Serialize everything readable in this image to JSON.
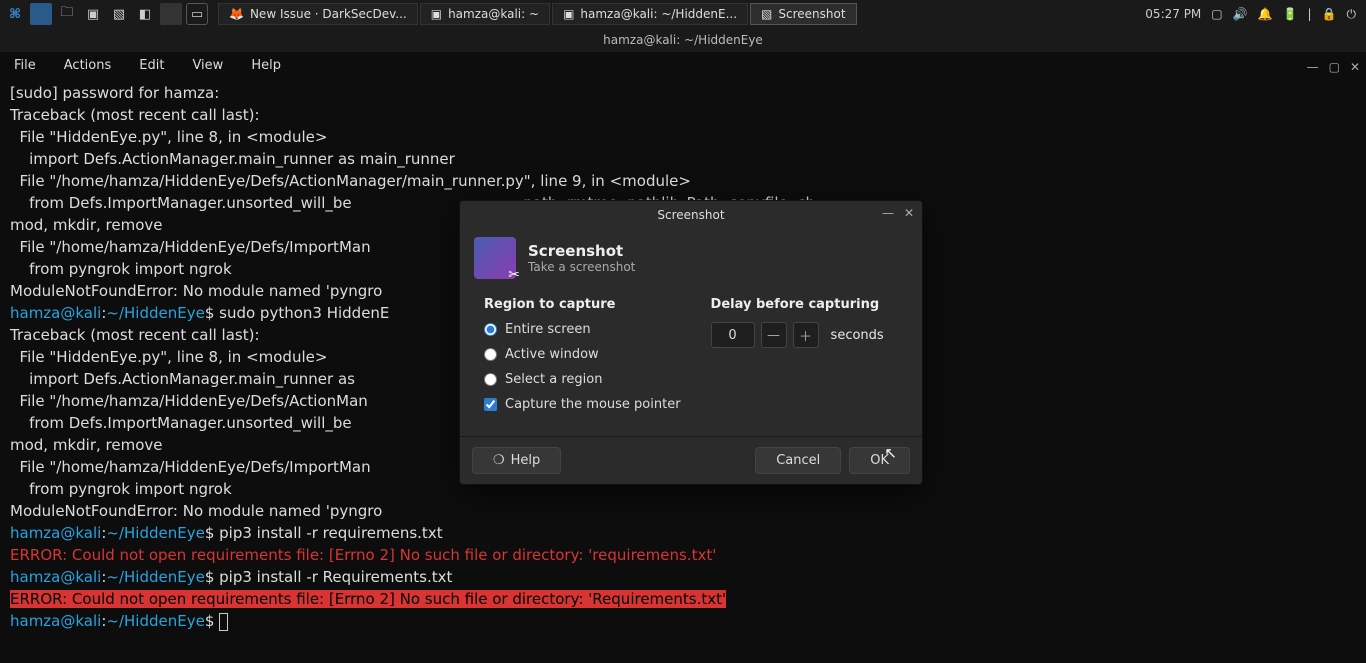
{
  "panel": {
    "tasks": [
      {
        "icon": "🦊",
        "label": "New Issue · DarkSecDev..."
      },
      {
        "icon": "▣",
        "label": "hamza@kali: ~"
      },
      {
        "icon": "▣",
        "label": "hamza@kali: ~/HiddenE..."
      },
      {
        "icon": "▧",
        "label": "Screenshot"
      }
    ],
    "clock": "05:27 PM"
  },
  "terminal": {
    "title": "hamza@kali: ~/HiddenEye",
    "menus": [
      "File",
      "Actions",
      "Edit",
      "View",
      "Help"
    ],
    "lines": [
      {
        "t": "plain",
        "s": "[sudo] password for hamza:"
      },
      {
        "t": "plain",
        "s": "Traceback (most recent call last):"
      },
      {
        "t": "plain",
        "s": "  File \"HiddenEye.py\", line 8, in <module>"
      },
      {
        "t": "plain",
        "s": "    import Defs.ActionManager.main_runner as main_runner"
      },
      {
        "t": "plain",
        "s": "  File \"/home/hamza/HiddenEye/Defs/ActionManager/main_runner.py\", line 9, in <module>"
      },
      {
        "t": "plain",
        "s": "    from Defs.ImportManager.unsorted_will_be                                  , path, rmtree, pathlib_Path, copyfile, ch"
      },
      {
        "t": "plain",
        "s": "mod, mkdir, remove"
      },
      {
        "t": "plain",
        "s": "  File \"/home/hamza/HiddenEye/Defs/ImportMan                                  <module>"
      },
      {
        "t": "plain",
        "s": "    from pyngrok import ngrok"
      },
      {
        "t": "plain",
        "s": "ModuleNotFoundError: No module named 'pyngro"
      },
      {
        "t": "prompt",
        "u": "hamza@kali",
        "p": "~/HiddenEye",
        "c": "sudo python3 HiddenE"
      },
      {
        "t": "plain",
        "s": "Traceback (most recent call last):"
      },
      {
        "t": "plain",
        "s": "  File \"HiddenEye.py\", line 8, in <module>"
      },
      {
        "t": "plain",
        "s": "    import Defs.ActionManager.main_runner as"
      },
      {
        "t": "plain",
        "s": "  File \"/home/hamza/HiddenEye/Defs/ActionMan"
      },
      {
        "t": "plain",
        "s": "    from Defs.ImportManager.unsorted_will_be                                  , path, rmtree, pathlib_Path, copyfile, ch"
      },
      {
        "t": "plain",
        "s": "mod, mkdir, remove"
      },
      {
        "t": "plain",
        "s": "  File \"/home/hamza/HiddenEye/Defs/ImportMan                                  <module>"
      },
      {
        "t": "plain",
        "s": "    from pyngrok import ngrok"
      },
      {
        "t": "plain",
        "s": "ModuleNotFoundError: No module named 'pyngro"
      },
      {
        "t": "prompt",
        "u": "hamza@kali",
        "p": "~/HiddenEye",
        "c": "pip3 install -r requiremens.txt"
      },
      {
        "t": "err",
        "s": "ERROR: Could not open requirements file: [Errno 2] No such file or directory: 'requiremens.txt'"
      },
      {
        "t": "prompt",
        "u": "hamza@kali",
        "p": "~/HiddenEye",
        "c": "pip3 install -r Requirements.txt"
      },
      {
        "t": "errhl",
        "s": "ERROR: Could not open requirements file: [Errno 2] No such file or directory: 'Requirements.txt'"
      },
      {
        "t": "prompt",
        "u": "hamza@kali",
        "p": "~/HiddenEye",
        "c": "",
        "cursor": true
      }
    ]
  },
  "dialog": {
    "title": "Screenshot",
    "heading": "Screenshot",
    "subheading": "Take a screenshot",
    "region_label": "Region to capture",
    "opts": {
      "entire": "Entire screen",
      "active": "Active window",
      "select": "Select a region"
    },
    "pointer": "Capture the mouse pointer",
    "delay_label": "Delay before capturing",
    "delay_val": "0",
    "delay_unit": "seconds",
    "help": "Help",
    "cancel": "Cancel",
    "ok": "OK"
  }
}
